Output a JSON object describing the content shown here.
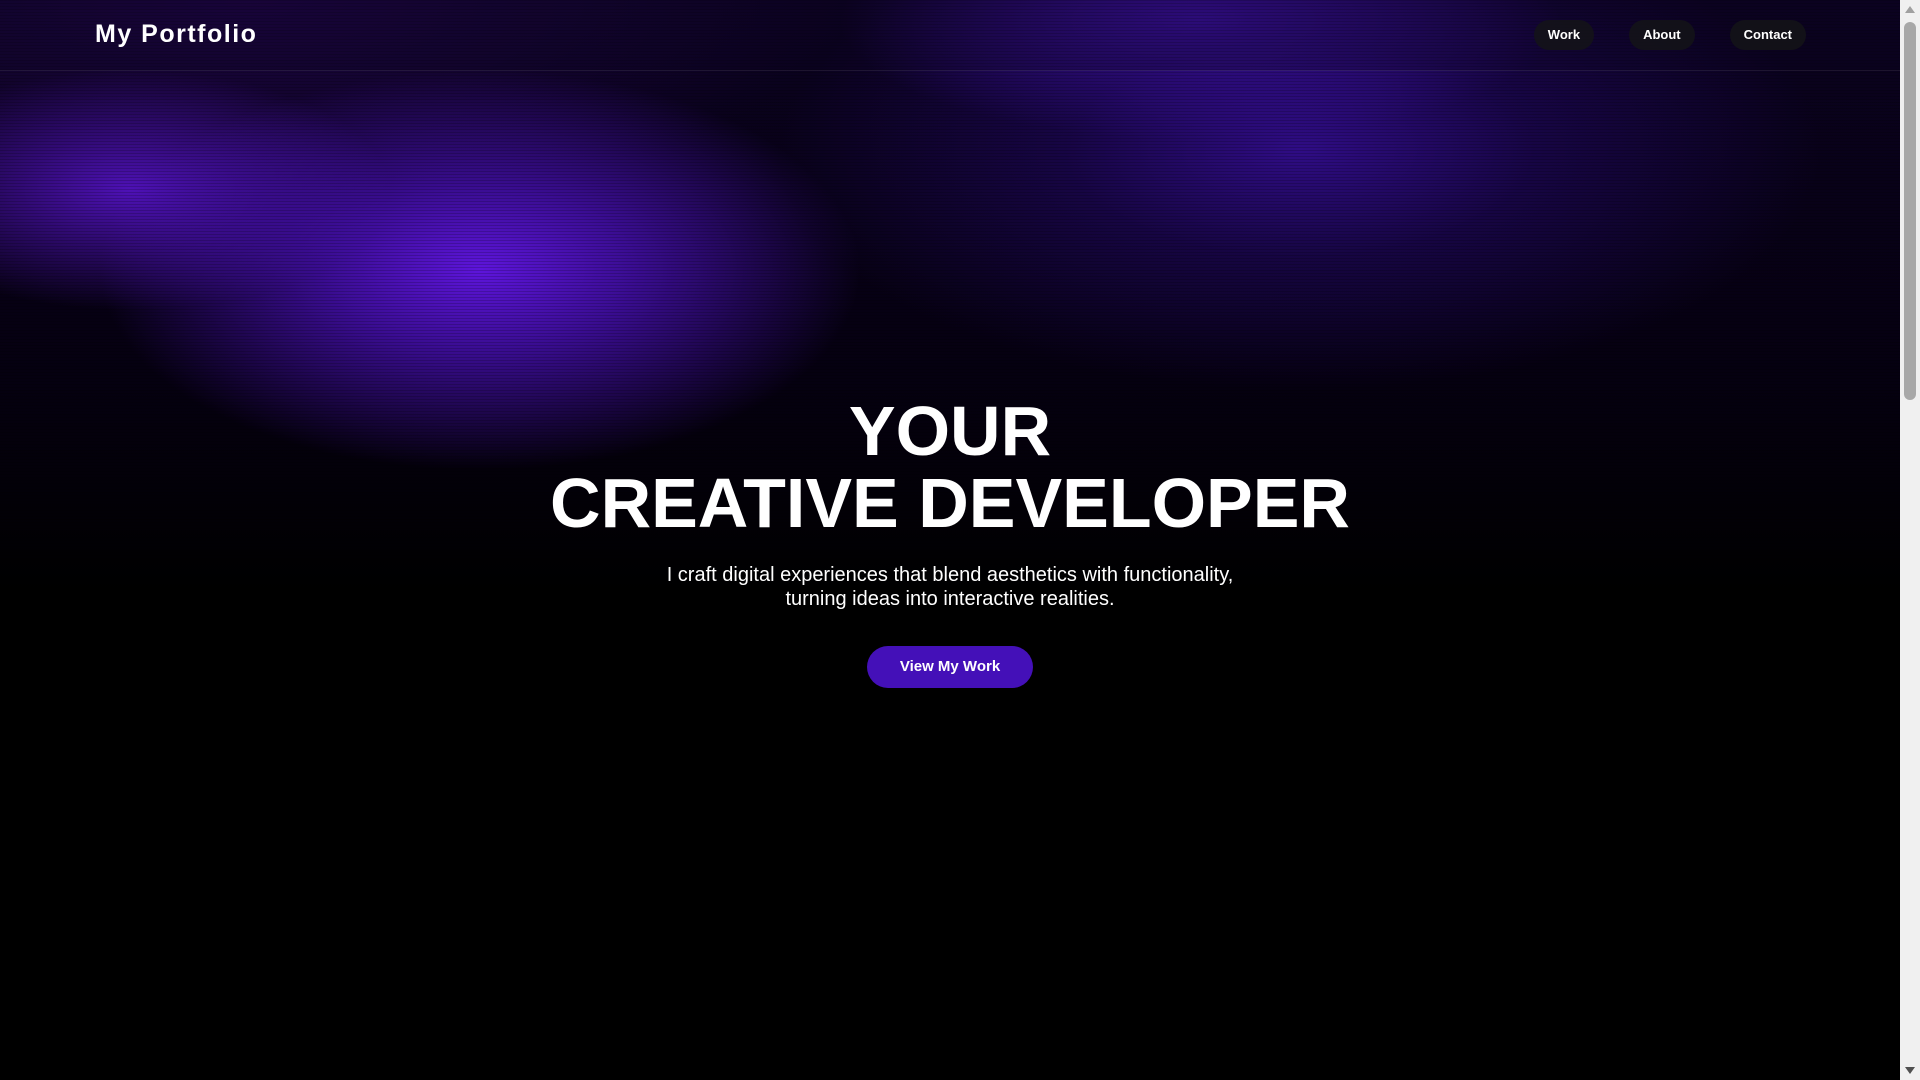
{
  "header": {
    "logo": "My Portfolio",
    "nav": [
      {
        "label": "Work"
      },
      {
        "label": "About"
      },
      {
        "label": "Contact"
      }
    ]
  },
  "hero": {
    "title_line1": "YOUR",
    "title_line2": "CREATIVE DEVELOPER",
    "subtitle_line1": "I craft digital experiences that blend aesthetics with functionality,",
    "subtitle_line2": "turning ideas into interactive realities.",
    "cta_label": "View My Work"
  },
  "colors": {
    "background": "#000000",
    "accent_purple": "#4410b8",
    "glow_purple": "#6216e6",
    "text": "#ffffff"
  },
  "icons": {
    "scroll_up": "scroll-up-arrow-icon",
    "scroll_down": "scroll-down-arrow-icon"
  }
}
